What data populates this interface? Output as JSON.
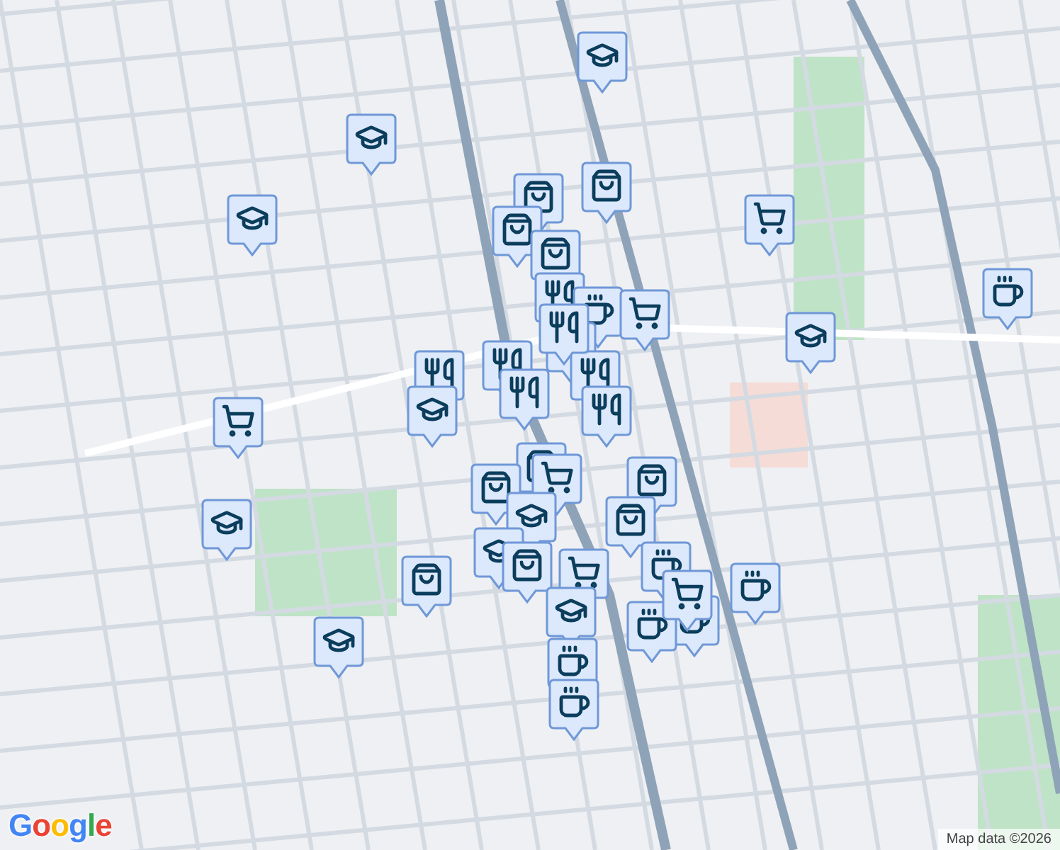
{
  "map": {
    "markers": [
      {
        "kind": "school"
      },
      {
        "kind": "school"
      },
      {
        "kind": "school"
      },
      {
        "kind": "bag"
      },
      {
        "kind": "bag"
      },
      {
        "kind": "cart"
      },
      {
        "kind": "bag"
      },
      {
        "kind": "bag"
      },
      {
        "kind": "food"
      },
      {
        "kind": "cup"
      },
      {
        "kind": "cart"
      },
      {
        "kind": "food"
      },
      {
        "kind": "school"
      },
      {
        "kind": "cup"
      },
      {
        "kind": "food"
      },
      {
        "kind": "food"
      },
      {
        "kind": "food"
      },
      {
        "kind": "food"
      },
      {
        "kind": "food"
      },
      {
        "kind": "school"
      },
      {
        "kind": "food"
      },
      {
        "kind": "cart"
      },
      {
        "kind": "bag"
      },
      {
        "kind": "cart"
      },
      {
        "kind": "bag"
      },
      {
        "kind": "bag"
      },
      {
        "kind": "school"
      },
      {
        "kind": "bag"
      },
      {
        "kind": "school"
      },
      {
        "kind": "school"
      },
      {
        "kind": "bag"
      },
      {
        "kind": "cart"
      },
      {
        "kind": "bag"
      },
      {
        "kind": "cup"
      },
      {
        "kind": "cart"
      },
      {
        "kind": "cup"
      },
      {
        "kind": "school"
      },
      {
        "kind": "cup"
      },
      {
        "kind": "cup"
      },
      {
        "kind": "school"
      },
      {
        "kind": "cup"
      },
      {
        "kind": "cup"
      }
    ]
  },
  "logo": "Google",
  "attribution": "Map data ©2026"
}
